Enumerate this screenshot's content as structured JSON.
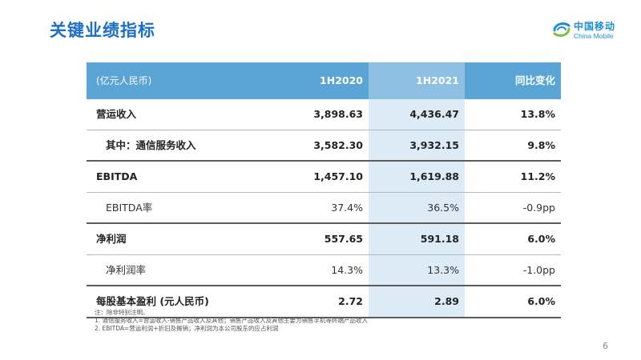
{
  "title": "关键业绩指标",
  "logo": {
    "cn": "中国移动",
    "en": "China Mobile"
  },
  "table": {
    "headers": [
      "(亿元人民币)",
      "1H2020",
      "1H2021",
      "同比变化"
    ],
    "rows": [
      {
        "label": "营运收入",
        "v2020": "3,898.63",
        "v2021": "4,436.47",
        "change": "13.8%"
      },
      {
        "label": "其中：通信服务收入",
        "v2020": "3,582.30",
        "v2021": "3,932.15",
        "change": "9.8%"
      },
      {
        "label": "EBITDA",
        "v2020": "1,457.10",
        "v2021": "1,619.88",
        "change": "11.2%"
      },
      {
        "label": "EBITDA率",
        "v2020": "37.4%",
        "v2021": "36.5%",
        "change": "-0.9pp"
      },
      {
        "label": "净利润",
        "v2020": "557.65",
        "v2021": "591.18",
        "change": "6.0%"
      },
      {
        "label": "净利润率",
        "v2020": "14.3%",
        "v2021": "13.3%",
        "change": "-1.0pp"
      },
      {
        "label": "每股基本盈利 (元人民币)",
        "v2020": "2.72",
        "v2021": "2.89",
        "change": "6.0%"
      }
    ]
  },
  "notes": [
    "注：除非特别注明。",
    "1.    通信服务收入=营运收入-销售产品收入及其他；销售产品收入及其他主要为销售手机等终端产品收入",
    "2.    EBITDA=营运利润+折旧及摊销；净利润为本公司股东的应占利润"
  ],
  "page_number": "6",
  "colors": {
    "title": "#1b6fc4",
    "header_bg": "#5aa4d6",
    "header_band": "#8ec0e4",
    "column_band": "#dcebf6"
  }
}
